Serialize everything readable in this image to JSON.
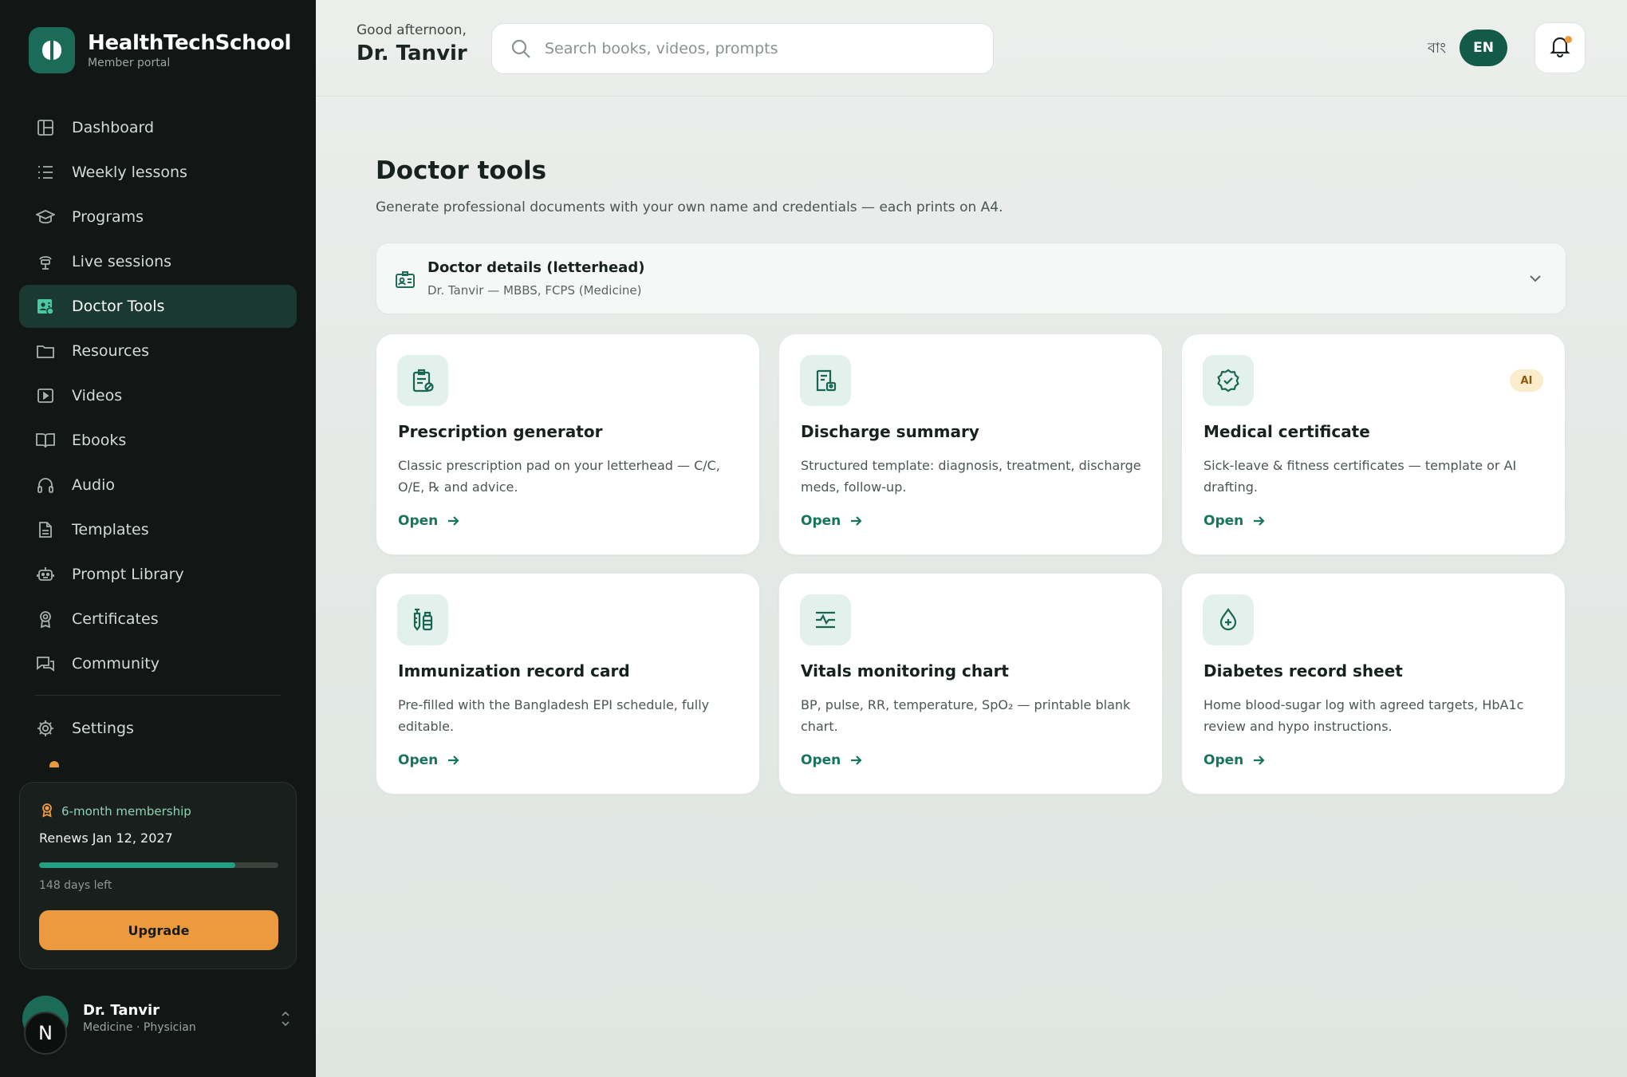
{
  "brand": {
    "title": "HealthTechSchool",
    "subtitle": "Member portal"
  },
  "sidebar": {
    "items": [
      {
        "label": "Dashboard",
        "icon": "dashboard-icon"
      },
      {
        "label": "Weekly lessons",
        "icon": "list-icon"
      },
      {
        "label": "Programs",
        "icon": "graduation-cap-icon"
      },
      {
        "label": "Live sessions",
        "icon": "broadcast-icon"
      },
      {
        "label": "Doctor Tools",
        "icon": "clipboard-user-icon",
        "active": true
      },
      {
        "label": "Resources",
        "icon": "folder-icon"
      },
      {
        "label": "Videos",
        "icon": "video-icon"
      },
      {
        "label": "Ebooks",
        "icon": "book-icon"
      },
      {
        "label": "Audio",
        "icon": "headphones-icon"
      },
      {
        "label": "Templates",
        "icon": "document-icon"
      },
      {
        "label": "Prompt Library",
        "icon": "robot-icon"
      },
      {
        "label": "Certificates",
        "icon": "award-icon"
      },
      {
        "label": "Community",
        "icon": "chat-icon"
      },
      {
        "label": "Settings",
        "icon": "gear-icon"
      }
    ]
  },
  "membership": {
    "label": "6-month membership",
    "renews": "Renews Jan 12, 2027",
    "progress": 0.82,
    "days_left": "148 days left",
    "upgrade_label": "Upgrade"
  },
  "user": {
    "initial": "N",
    "name": "Dr. Tanvir",
    "role": "Medicine · Physician"
  },
  "header": {
    "greeting": "Good afternoon,",
    "name": "Dr. Tanvir",
    "search_placeholder": "Search books, videos, prompts",
    "lang_bn": "বাং",
    "lang_en": "EN"
  },
  "page": {
    "title": "Doctor tools",
    "subtitle": "Generate professional documents with your own name and credentials — each prints on A4."
  },
  "doctor_details": {
    "title": "Doctor details (letterhead)",
    "value": "Dr. Tanvir — MBBS, FCPS (Medicine)"
  },
  "tools": [
    {
      "title": "Prescription generator",
      "desc": "Classic prescription pad on your letterhead — C/C, O/E, ℞ and advice.",
      "open": "Open",
      "icon": "prescription-icon"
    },
    {
      "title": "Discharge summary",
      "desc": "Structured template: diagnosis, treatment, discharge meds, follow-up.",
      "open": "Open",
      "icon": "discharge-icon"
    },
    {
      "title": "Medical certificate",
      "desc": "Sick-leave & fitness certificates — template or AI drafting.",
      "open": "Open",
      "icon": "badge-check-icon",
      "badge": "AI"
    },
    {
      "title": "Immunization record card",
      "desc": "Pre-filled with the Bangladesh EPI schedule, fully editable.",
      "open": "Open",
      "icon": "syringe-icon"
    },
    {
      "title": "Vitals monitoring chart",
      "desc": "BP, pulse, RR, temperature, SpO₂ — printable blank chart.",
      "open": "Open",
      "icon": "vitals-icon"
    },
    {
      "title": "Diabetes record sheet",
      "desc": "Home blood-sugar log with agreed targets, HbA1c review and hypo instructions.",
      "open": "Open",
      "icon": "droplet-icon"
    }
  ]
}
